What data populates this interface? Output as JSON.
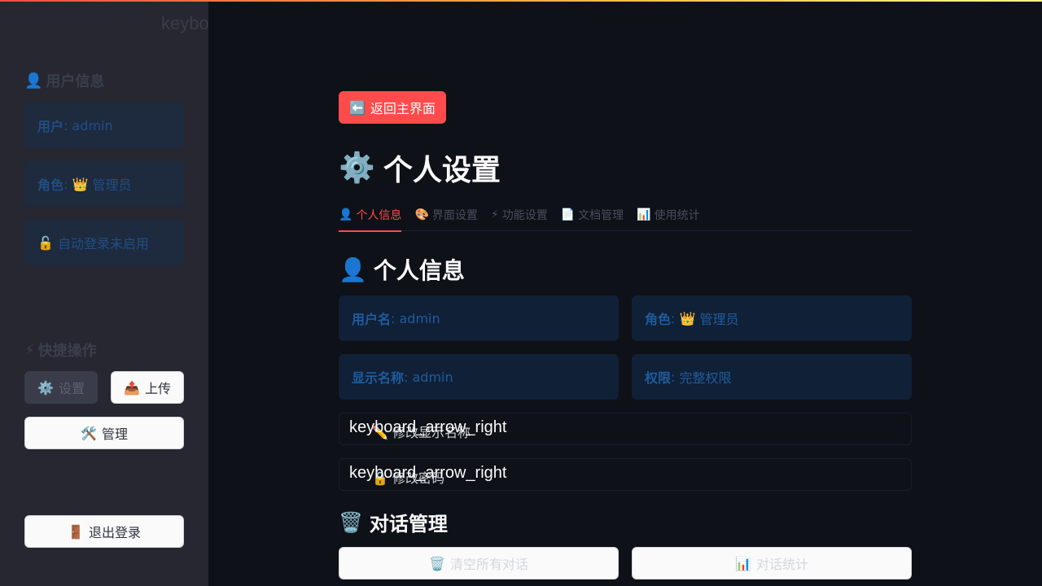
{
  "colors": {
    "primary": "#ff4b4b",
    "background": "#0e1117",
    "sidebar": "#262730",
    "info_text": "#1f5c9e"
  },
  "sidebar": {
    "keyword_text": "keyboard_double_arrow_left",
    "user_info": {
      "icon": "👤",
      "title": "用户信息",
      "user_label": "用户",
      "user_value": "admin",
      "role_label": "角色",
      "role_icon": "👑",
      "role_value": "管理员",
      "auto_login_icon": "🔓",
      "auto_login_text": "自动登录未启用"
    },
    "quick_actions": {
      "icon": "⚡",
      "title": "快捷操作",
      "settings_icon": "⚙️",
      "settings_label": "设置",
      "upload_icon": "📤",
      "upload_label": "上传",
      "manage_icon": "🛠️",
      "manage_label": "管理"
    },
    "logout_icon": "🚪",
    "logout_label": "退出登录"
  },
  "main": {
    "back_icon": "⬅️",
    "back_label": "返回主界面",
    "title_icon": "⚙️",
    "title": "个人设置",
    "tabs": [
      {
        "icon": "👤",
        "label": "个人信息"
      },
      {
        "icon": "🎨",
        "label": "界面设置"
      },
      {
        "icon": "⚡",
        "label": "功能设置"
      },
      {
        "icon": "📄",
        "label": "文档管理"
      },
      {
        "icon": "📊",
        "label": "使用统计"
      }
    ],
    "personal_info": {
      "icon": "👤",
      "title": "个人信息",
      "username_label": "用户名",
      "username_value": "admin",
      "role_label": "角色",
      "role_icon": "👑",
      "role_value": "管理员",
      "display_name_label": "显示名称",
      "display_name_value": "admin",
      "permission_label": "权限",
      "permission_value": "完整权限"
    },
    "expanders": [
      {
        "icon_text": "keyboard_arrow_right",
        "icon": "✏️",
        "label": "修改显示名称"
      },
      {
        "icon_text": "keyboard_arrow_right",
        "icon": "🔒",
        "label": "修改密码"
      }
    ],
    "chat_management": {
      "icon": "🗑️",
      "title": "对话管理",
      "clear_icon": "🗑️",
      "clear_label": "清空所有对话",
      "stats_icon": "📊",
      "stats_label": "对话统计"
    }
  }
}
